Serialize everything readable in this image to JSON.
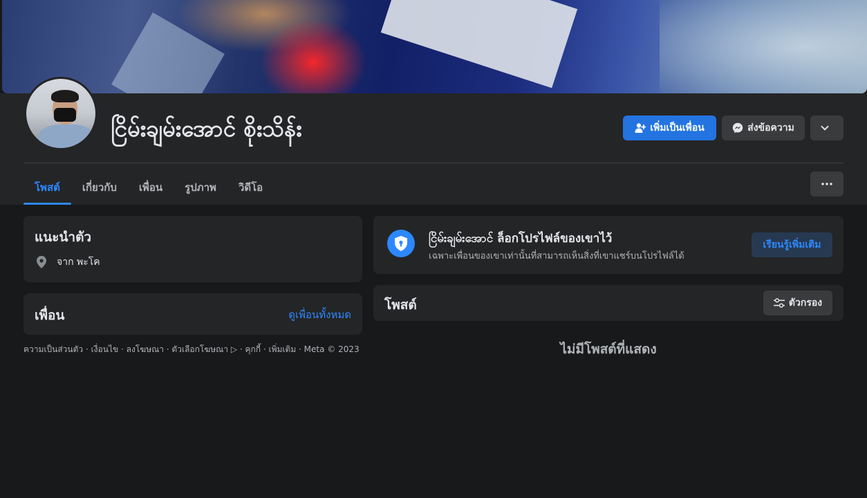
{
  "profile": {
    "name": "ငြိမ်းချမ်းအောင် စိုးသိန်း",
    "add_friend_label": "เพิ่มเป็นเพื่อน",
    "message_label": "ส่งข้อความ"
  },
  "tabs": [
    {
      "label": "โพสต์",
      "active": true
    },
    {
      "label": "เกี่ยวกับ",
      "active": false
    },
    {
      "label": "เพื่อน",
      "active": false
    },
    {
      "label": "รูปภาพ",
      "active": false
    },
    {
      "label": "วิดีโอ",
      "active": false
    }
  ],
  "intro": {
    "title": "แนะนำตัว",
    "location": "จาก พะโค"
  },
  "friends": {
    "title": "เพื่อน",
    "see_all": "ดูเพื่อนทั้งหมด"
  },
  "footer": "ความเป็นส่วนตัว · เงื่อนไข · ลงโฆษณา · ตัวเลือกโฆษณา ▷ · คุกกี้ · เพิ่มเติม · Meta © 2023",
  "locked": {
    "title": "ငြိမ်းချမ်းအောင် ล็อกโปรไฟล์ของเขาไว้",
    "subtitle": "เฉพาะเพื่อนของเขาเท่านั้นที่สามารถเห็นสิ่งที่เขาแชร์บนโปรไฟล์ได้",
    "learn_more": "เรียนรู้เพิ่มเติม"
  },
  "posts": {
    "title": "โพสต์",
    "filter_label": "ตัวกรอง",
    "empty": "ไม่มีโพสต์ที่แสดง"
  },
  "colors": {
    "accent": "#2d88ff",
    "primary_button": "#2374e1",
    "card": "#242526",
    "page": "#18191a"
  }
}
